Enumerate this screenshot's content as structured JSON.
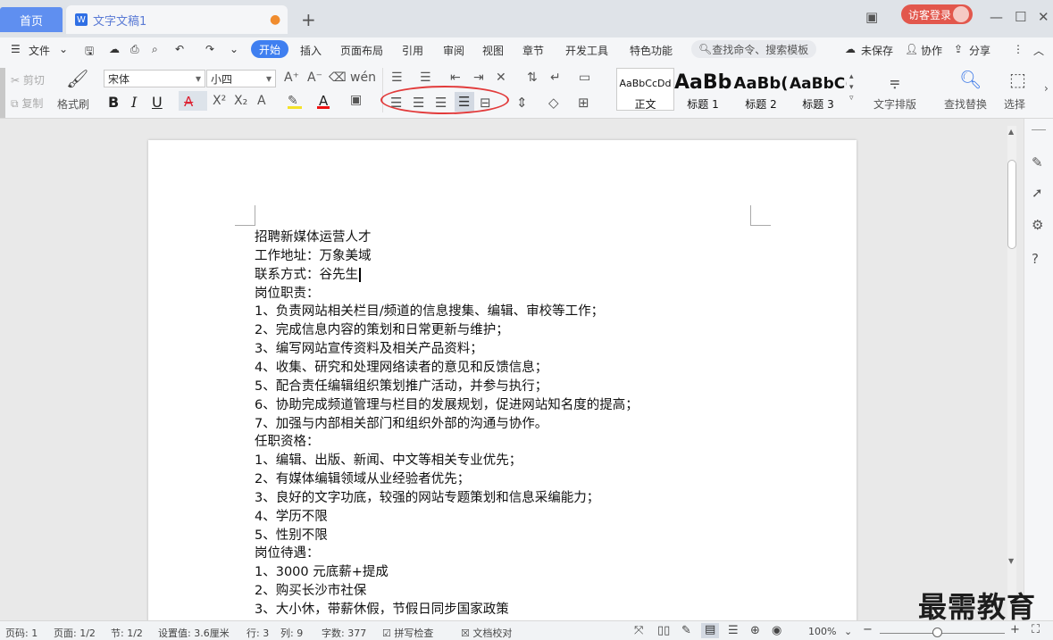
{
  "titlebar": {
    "home_tab": "首页",
    "doc_tab": "文字文稿1",
    "doc_tab_icon": "W",
    "new_tab": "+",
    "login": "访客登录"
  },
  "menu": {
    "file": "文件",
    "start": "开始",
    "items": [
      "插入",
      "页面布局",
      "引用",
      "审阅",
      "视图",
      "章节",
      "开发工具",
      "特色功能"
    ],
    "search": "查找命令、搜索模板",
    "unsaved": "未保存",
    "collab": "协作",
    "share": "分享"
  },
  "ribbon": {
    "cut": "剪切",
    "copy": "复制",
    "format_painter": "格式刷",
    "font_name": "宋体",
    "font_size": "小四",
    "styles": [
      {
        "preview": "AaBbCcDd",
        "label": "正文"
      },
      {
        "preview": "AaBb",
        "label": "标题 1"
      },
      {
        "preview": "AaBb(",
        "label": "标题 2"
      },
      {
        "preview": "AaBbC(",
        "label": "标题 3"
      }
    ],
    "text_layout": "文字排版",
    "find_replace": "查找替换",
    "select": "选择"
  },
  "document": {
    "lines": [
      "招聘新媒体运营人才",
      "工作地址：万象美域",
      "联系方式：谷先生",
      "岗位职责：",
      "1、负责网站相关栏目/频道的信息搜集、编辑、审校等工作；",
      "2、完成信息内容的策划和日常更新与维护；",
      "3、编写网站宣传资料及相关产品资料；",
      "4、收集、研究和处理网络读者的意见和反馈信息；",
      "5、配合责任编辑组织策划推广活动，并参与执行；",
      "6、协助完成频道管理与栏目的发展规划，促进网站知名度的提高；",
      "7、加强与内部相关部门和组织外部的沟通与协作。",
      "任职资格：",
      "1、编辑、出版、新闻、中文等相关专业优先；",
      "2、有媒体编辑领域从业经验者优先；",
      "3、良好的文字功底，较强的网站专题策划和信息采编能力；",
      "4、学历不限",
      "5、性别不限",
      "岗位待遇：",
      "1、3000 元底薪+提成",
      "2、购买长沙市社保",
      "3、大小休，带薪休假，节假日同步国家政策"
    ]
  },
  "status": {
    "page_code": "页码: 1",
    "pages": "页面: 1/2",
    "section": "节: 1/2",
    "setting": "设置值: 3.6厘米",
    "row": "行: 3",
    "col": "列: 9",
    "words": "字数: 377",
    "spell": "拼写检查",
    "proof": "文档校对",
    "zoom": "100%"
  },
  "watermark": "最需教育",
  "colors": {
    "accent": "#3f7ff0",
    "login": "#e2574c",
    "highlight_oval": "#e23b3b"
  }
}
